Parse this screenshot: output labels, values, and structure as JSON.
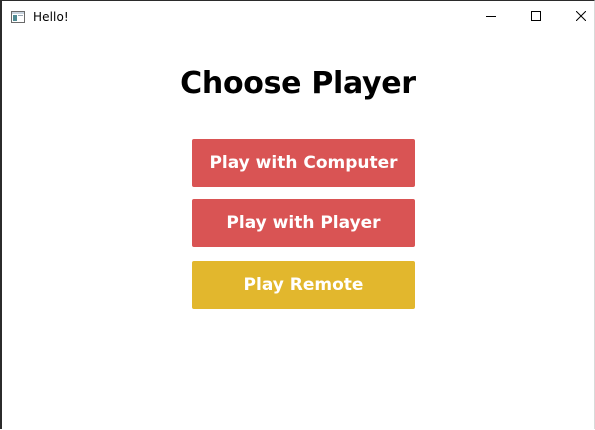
{
  "window": {
    "title": "Hello!",
    "controls": {
      "minimize_icon": "minimize-icon",
      "maximize_icon": "maximize-icon",
      "close_icon": "close-icon"
    }
  },
  "main": {
    "heading": "Choose Player",
    "buttons": [
      {
        "label": "Play with Computer",
        "color": "#d95454"
      },
      {
        "label": "Play with Player",
        "color": "#d95454"
      },
      {
        "label": "Play Remote",
        "color": "#e2b72d"
      }
    ]
  }
}
